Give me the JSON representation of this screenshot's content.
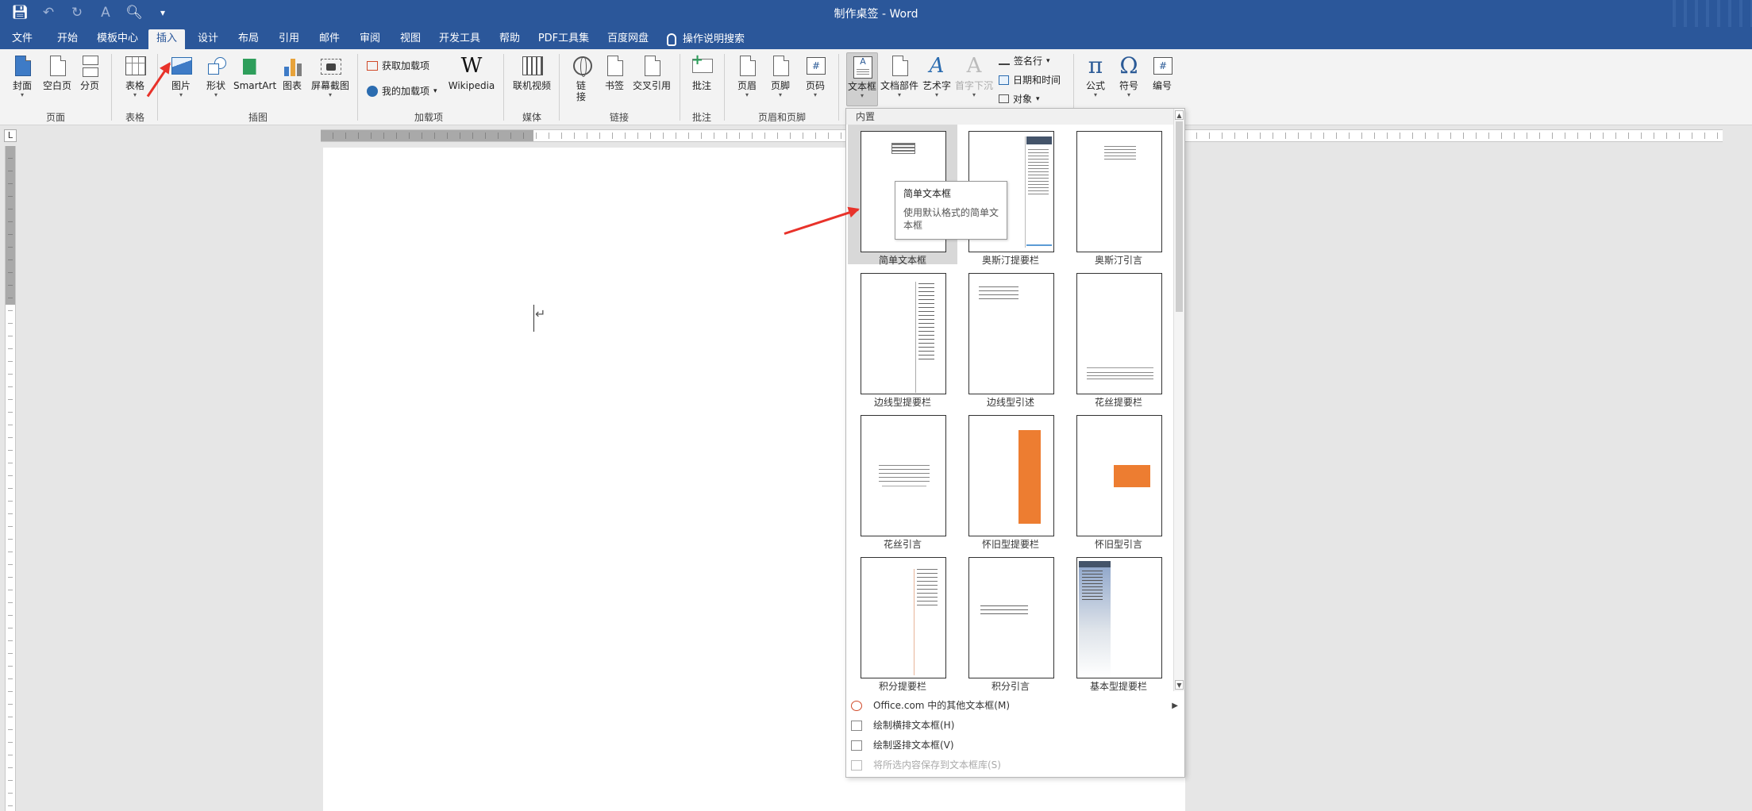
{
  "window": {
    "title": "制作桌签 - Word"
  },
  "qat": {
    "save_icon": "save-icon",
    "undo_icon": "undo-icon",
    "redo_icon": "redo-icon",
    "font_icon": "font-size-icon",
    "preview_icon": "print-preview-icon",
    "customize_icon": "customize-qat-icon"
  },
  "tabs": [
    {
      "label": "文件"
    },
    {
      "label": "开始"
    },
    {
      "label": "模板中心"
    },
    {
      "label": "插入"
    },
    {
      "label": "设计"
    },
    {
      "label": "布局"
    },
    {
      "label": "引用"
    },
    {
      "label": "邮件"
    },
    {
      "label": "审阅"
    },
    {
      "label": "视图"
    },
    {
      "label": "开发工具"
    },
    {
      "label": "帮助"
    },
    {
      "label": "PDF工具集"
    },
    {
      "label": "百度网盘"
    }
  ],
  "tell_me": "操作说明搜索",
  "ribbon": {
    "pages": {
      "cover": "封面",
      "blank": "空白页",
      "break": "分页",
      "group": "页面"
    },
    "tables": {
      "table": "表格",
      "group": "表格"
    },
    "illustrations": {
      "picture": "图片",
      "shapes": "形状",
      "smartart": "SmartArt",
      "chart": "图表",
      "screenshot": "屏幕截图",
      "group": "插图"
    },
    "addins": {
      "get": "获取加载项",
      "my": "我的加载项",
      "wikipedia": "Wikipedia",
      "group": "加载项"
    },
    "media": {
      "video": "联机视频",
      "group": "媒体"
    },
    "links": {
      "link_a": "链",
      "link_b": "接",
      "bookmark": "书签",
      "crossref": "交叉引用",
      "group": "链接"
    },
    "comments": {
      "comment": "批注",
      "group": "批注"
    },
    "header_footer": {
      "header": "页眉",
      "footer": "页脚",
      "page_number": "页码",
      "group": "页眉和页脚"
    },
    "text": {
      "textbox": "文本框",
      "quickparts": "文档部件",
      "wordart": "艺术字",
      "dropcap": "首字下沉",
      "signature": "签名行",
      "datetime": "日期和时间",
      "object": "对象"
    },
    "symbols": {
      "equation": "公式",
      "symbol": "符号",
      "numbering": "编号"
    }
  },
  "gallery": {
    "header": "内置",
    "tiles": [
      {
        "caption": "简单文本框"
      },
      {
        "caption": "奥斯汀提要栏"
      },
      {
        "caption": "奥斯汀引言"
      },
      {
        "caption": "边线型提要栏"
      },
      {
        "caption": "边线型引述"
      },
      {
        "caption": "花丝提要栏"
      },
      {
        "caption": "花丝引言"
      },
      {
        "caption": "怀旧型提要栏"
      },
      {
        "caption": "怀旧型引言"
      },
      {
        "caption": "积分提要栏"
      },
      {
        "caption": "积分引言"
      },
      {
        "caption": "基本型提要栏"
      }
    ],
    "tooltip": {
      "title": "简单文本框",
      "desc_1": "使用默认格式的简单文",
      "desc_2": "本框"
    },
    "footer": [
      {
        "label": "Office.com 中的其他文本框(M)"
      },
      {
        "label": "绘制横排文本框(H)"
      },
      {
        "label": "绘制竖排文本框(V)"
      },
      {
        "label": "将所选内容保存到文本框库(S)"
      }
    ]
  },
  "ruler": {
    "corner": "L"
  },
  "document": {
    "paragraph_mark": "↵"
  },
  "colors": {
    "accent": "#2b579a",
    "ribbon": "#f3f3f3",
    "annotation": "#e8322a",
    "orange": "#ed7d31"
  }
}
